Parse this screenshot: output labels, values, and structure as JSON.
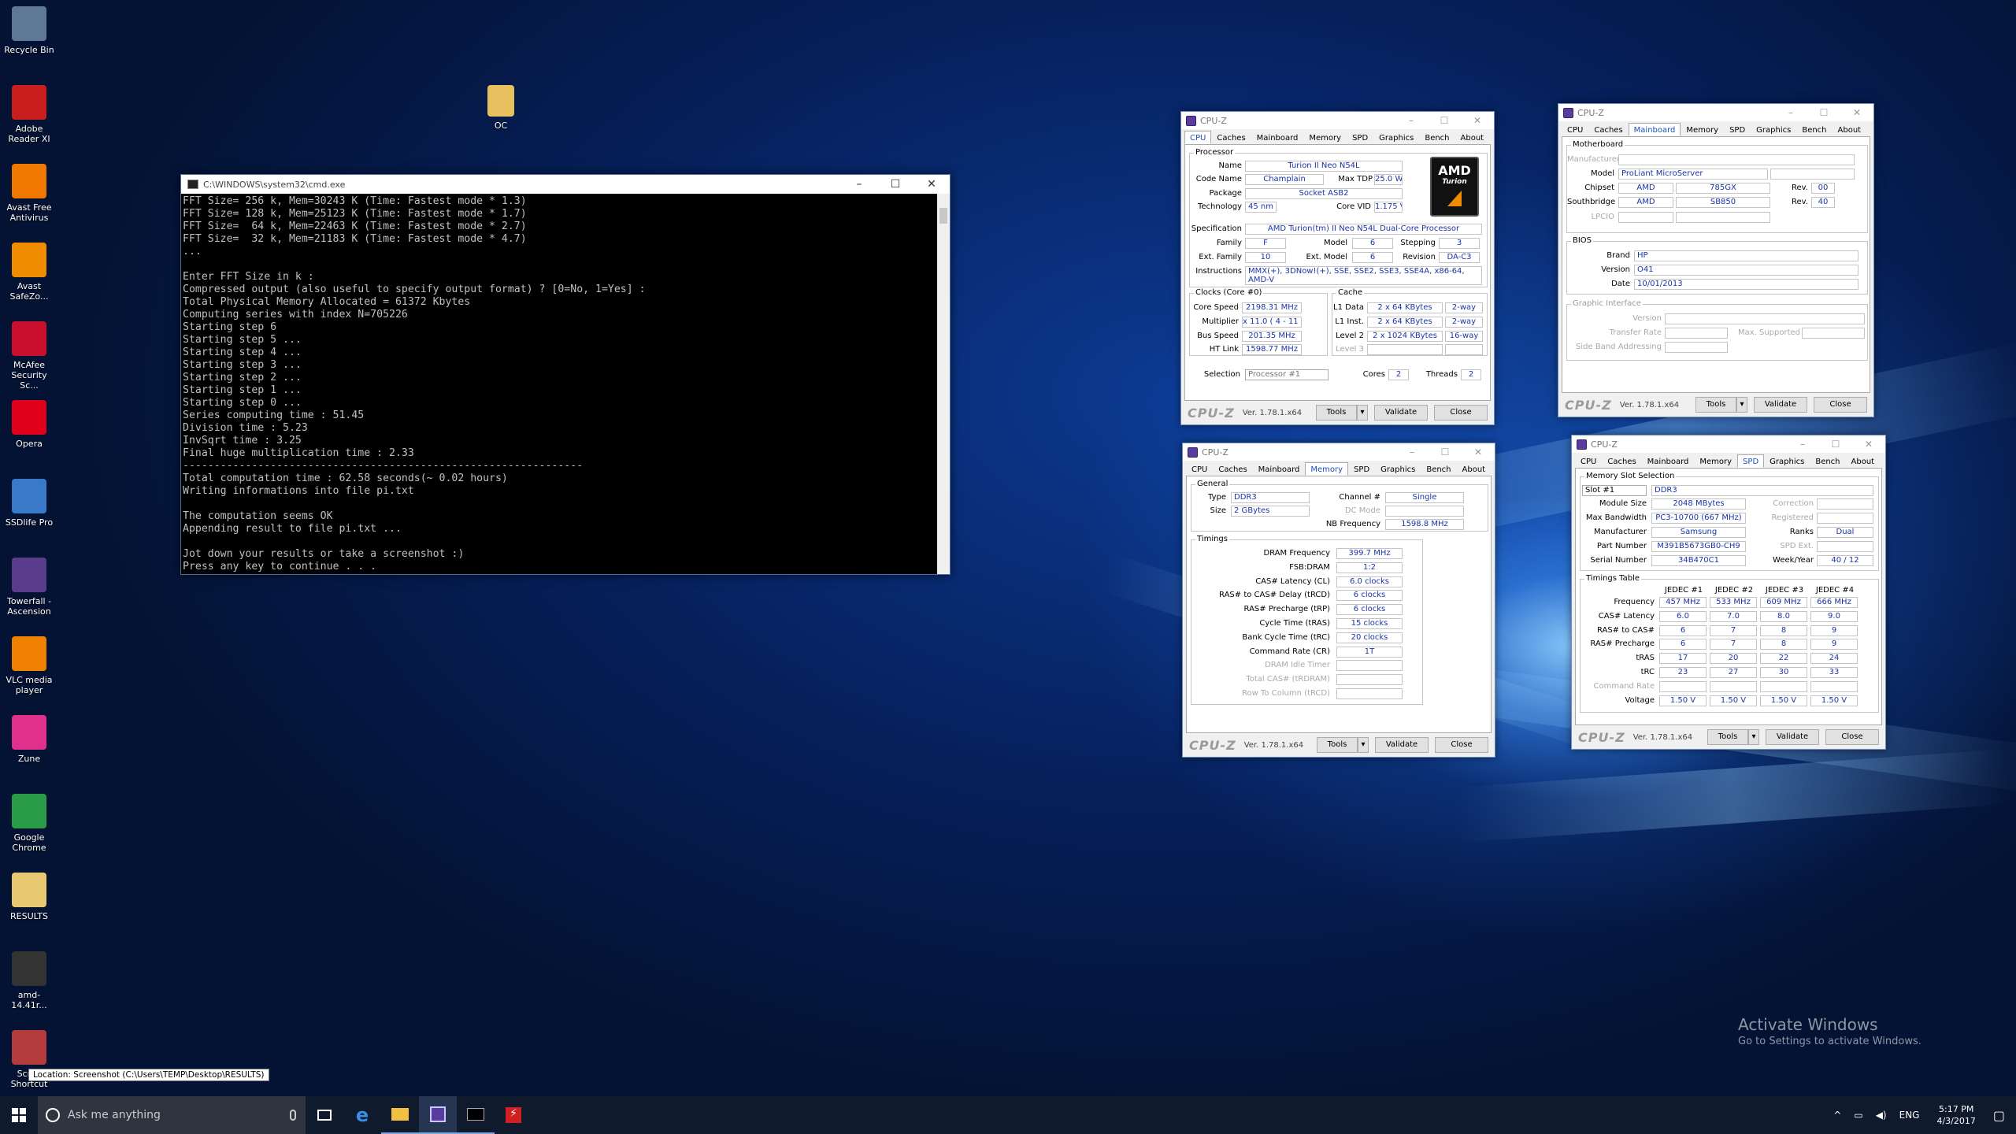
{
  "desktop_icons": [
    {
      "label": "Recycle Bin",
      "icon": "recycle-bin-icon",
      "color": "#607898"
    },
    {
      "label": "Adobe Reader XI",
      "icon": "adobe-reader-icon",
      "color": "#c81e1e"
    },
    {
      "label": "Avast Free Antivirus",
      "icon": "avast-icon",
      "color": "#f07800"
    },
    {
      "label": "Avast SafeZo...",
      "icon": "avast-safezone-icon",
      "color": "#f08c00"
    },
    {
      "label": "McAfee Security Sc...",
      "icon": "mcafee-icon",
      "color": "#c8102e"
    },
    {
      "label": "Opera",
      "icon": "opera-icon",
      "color": "#e0001a"
    },
    {
      "label": "SSDlife Pro",
      "icon": "ssdlife-icon",
      "color": "#3a78c8"
    },
    {
      "label": "Towerfall - Ascension",
      "icon": "towerfall-icon",
      "color": "#5a3c8c"
    },
    {
      "label": "VLC media player",
      "icon": "vlc-icon",
      "color": "#f08000"
    },
    {
      "label": "Zune",
      "icon": "zune-icon",
      "color": "#e0308c"
    },
    {
      "label": "Google Chrome",
      "icon": "chrome-icon",
      "color": "#2a9c48"
    },
    {
      "label": "RESULTS",
      "icon": "folder-document-icon",
      "color": "#e8c870"
    },
    {
      "label": "amd-14.41r...",
      "icon": "amd-installer-icon",
      "color": "#333333"
    },
    {
      "label": "Scree Shortcut",
      "icon": "screenshot-shortcut-icon",
      "color": "#b43c3c"
    }
  ],
  "folder_icon": {
    "label": "OC"
  },
  "tooltip": "Location: Screenshot (C:\\Users\\TEMP\\Desktop\\RESULTS)",
  "cmd": {
    "title": "C:\\WINDOWS\\system32\\cmd.exe",
    "lines": [
      "FFT Size= 256 k, Mem=30243 K (Time: Fastest mode * 1.3)",
      "FFT Size= 128 k, Mem=25123 K (Time: Fastest mode * 1.7)",
      "FFT Size=  64 k, Mem=22463 K (Time: Fastest mode * 2.7)",
      "FFT Size=  32 k, Mem=21183 K (Time: Fastest mode * 4.7)",
      "...",
      "",
      "Enter FFT Size in k :",
      "Compressed output (also useful to specify output format) ? [0=No, 1=Yes] :",
      "Total Physical Memory Allocated = 61372 Kbytes",
      "Computing series with index N=705226",
      "Starting step 6",
      "Starting step 5 ...",
      "Starting step 4 ...",
      "Starting step 3 ...",
      "Starting step 2 ...",
      "Starting step 1 ...",
      "Starting step 0 ...",
      "Series computing time : 51.45",
      "Division time : 5.23",
      "InvSqrt time : 3.25",
      "Final huge multiplication time : 2.33",
      "----------------------------------------------------------------",
      "Total computation time : 62.58 seconds(~ 0.02 hours)",
      "Writing informations into file pi.txt",
      "",
      "The computation seems OK",
      "Appending result to file pi.txt ...",
      "",
      "Jot down your results or take a screenshot :)",
      "Press any key to continue . . ."
    ]
  },
  "cpuz_common": {
    "title": "CPU-Z",
    "tabs": [
      "CPU",
      "Caches",
      "Mainboard",
      "Memory",
      "SPD",
      "Graphics",
      "Bench",
      "About"
    ],
    "brand": "CPU-Z",
    "version": "Ver. 1.78.1.x64",
    "tools": "Tools",
    "validate": "Validate",
    "close": "Close"
  },
  "cpu_tab": {
    "processor_group": "Processor",
    "name_label": "Name",
    "name": "Turion II Neo N54L",
    "codename_label": "Code Name",
    "codename": "Champlain",
    "maxtdp_label": "Max TDP",
    "maxtdp": "25.0 W",
    "package_label": "Package",
    "package": "Socket ASB2",
    "technology_label": "Technology",
    "technology": "45 nm",
    "corevid_label": "Core VID",
    "corevid": "1.175 V",
    "spec_label": "Specification",
    "spec": "AMD Turion(tm) II Neo N54L Dual-Core Processor",
    "family_label": "Family",
    "family": "F",
    "model_label": "Model",
    "model": "6",
    "stepping_label": "Stepping",
    "stepping": "3",
    "extfamily_label": "Ext. Family",
    "extfamily": "10",
    "extmodel_label": "Ext. Model",
    "extmodel": "6",
    "revision_label": "Revision",
    "revision": "DA-C3",
    "instr_label": "Instructions",
    "instr1": "MMX(+), 3DNow!(+), SSE, SSE2, SSE3, SSE4A, x86-64,",
    "instr2": "AMD-V",
    "clocks_group": "Clocks (Core #0)",
    "corespeed_label": "Core Speed",
    "corespeed": "2198.31 MHz",
    "multiplier_label": "Multiplier",
    "multiplier": "x 11.0 ( 4 - 11 )",
    "busspeed_label": "Bus Speed",
    "busspeed": "201.35 MHz",
    "htlink_label": "HT Link",
    "htlink": "1598.77 MHz",
    "cache_group": "Cache",
    "l1d_label": "L1 Data",
    "l1d": "2 x 64 KBytes",
    "l1d_way": "2-way",
    "l1i_label": "L1 Inst.",
    "l1i": "2 x 64 KBytes",
    "l1i_way": "2-way",
    "l2_label": "Level 2",
    "l2": "2 x 1024 KBytes",
    "l2_way": "16-way",
    "l3_label": "Level 3",
    "selection_label": "Selection",
    "selection": "Processor #1",
    "cores_label": "Cores",
    "cores": "2",
    "threads_label": "Threads",
    "threads": "2",
    "logo_text": "AMD",
    "logo_sub": "Turion"
  },
  "mainboard_tab": {
    "mb_group": "Motherboard",
    "manufacturer_label": "Manufacturer",
    "model_label": "Model",
    "model": "ProLiant MicroServer",
    "chipset_label": "Chipset",
    "chipset_vendor": "AMD",
    "chipset": "785GX",
    "chipset_rev_label": "Rev.",
    "chipset_rev": "00",
    "southbridge_label": "Southbridge",
    "sb_vendor": "AMD",
    "sb": "SB850",
    "sb_rev_label": "Rev.",
    "sb_rev": "40",
    "lpcio_label": "LPCIO",
    "bios_group": "BIOS",
    "brand_label": "Brand",
    "brand": "HP",
    "version_label": "Version",
    "version": "O41",
    "date_label": "Date",
    "date": "10/01/2013",
    "gi_group": "Graphic Interface",
    "gi_version_label": "Version",
    "gi_transfer_label": "Transfer Rate",
    "gi_maxsup_label": "Max. Supported",
    "gi_sideband_label": "Side Band Addressing"
  },
  "memory_tab": {
    "general_group": "General",
    "type_label": "Type",
    "type": "DDR3",
    "size_label": "Size",
    "size": "2 GBytes",
    "channel_label": "Channel #",
    "channel": "Single",
    "dcmode_label": "DC Mode",
    "nbfreq_label": "NB Frequency",
    "nbfreq": "1598.8 MHz",
    "timings_group": "Timings",
    "rows": [
      {
        "label": "DRAM Frequency",
        "value": "399.7 MHz"
      },
      {
        "label": "FSB:DRAM",
        "value": "1:2"
      },
      {
        "label": "CAS# Latency (CL)",
        "value": "6.0 clocks"
      },
      {
        "label": "RAS# to CAS# Delay (tRCD)",
        "value": "6 clocks"
      },
      {
        "label": "RAS# Precharge (tRP)",
        "value": "6 clocks"
      },
      {
        "label": "Cycle Time (tRAS)",
        "value": "15 clocks"
      },
      {
        "label": "Bank Cycle Time (tRC)",
        "value": "20 clocks"
      },
      {
        "label": "Command Rate (CR)",
        "value": "1T"
      },
      {
        "label": "DRAM Idle Timer",
        "value": ""
      },
      {
        "label": "Total CAS# (tRDRAM)",
        "value": ""
      },
      {
        "label": "Row To Column (tRCD)",
        "value": ""
      }
    ]
  },
  "spd_tab": {
    "slot_group": "Memory Slot Selection",
    "slot": "Slot #1",
    "slot_type": "DDR3",
    "modsize_label": "Module Size",
    "modsize": "2048 MBytes",
    "correction_label": "Correction",
    "maxbw_label": "Max Bandwidth",
    "maxbw": "PC3-10700 (667 MHz)",
    "registered_label": "Registered",
    "manufacturer_label": "Manufacturer",
    "manufacturer": "Samsung",
    "ranks_label": "Ranks",
    "ranks": "Dual",
    "part_label": "Part Number",
    "part": "M391B5673GB0-CH9",
    "spdext_label": "SPD Ext.",
    "serial_label": "Serial Number",
    "serial": "34B470C1",
    "week_label": "Week/Year",
    "week": "40 / 12",
    "timings_group": "Timings Table",
    "columns": [
      "JEDEC #1",
      "JEDEC #2",
      "JEDEC #3",
      "JEDEC #4"
    ],
    "rows": [
      {
        "label": "Frequency",
        "values": [
          "457 MHz",
          "533 MHz",
          "609 MHz",
          "666 MHz"
        ]
      },
      {
        "label": "CAS# Latency",
        "values": [
          "6.0",
          "7.0",
          "8.0",
          "9.0"
        ]
      },
      {
        "label": "RAS# to CAS#",
        "values": [
          "6",
          "7",
          "8",
          "9"
        ]
      },
      {
        "label": "RAS# Precharge",
        "values": [
          "6",
          "7",
          "8",
          "9"
        ]
      },
      {
        "label": "tRAS",
        "values": [
          "17",
          "20",
          "22",
          "24"
        ]
      },
      {
        "label": "tRC",
        "values": [
          "23",
          "27",
          "30",
          "33"
        ]
      },
      {
        "label": "Command Rate",
        "values": [
          "",
          "",
          "",
          ""
        ]
      },
      {
        "label": "Voltage",
        "values": [
          "1.50 V",
          "1.50 V",
          "1.50 V",
          "1.50 V"
        ]
      }
    ]
  },
  "activation": {
    "line1": "Activate Windows",
    "line2": "Go to Settings to activate Windows."
  },
  "taskbar": {
    "search_placeholder": "Ask me anything",
    "lang": "ENG",
    "time": "5:17 PM",
    "date": "4/3/2017"
  }
}
